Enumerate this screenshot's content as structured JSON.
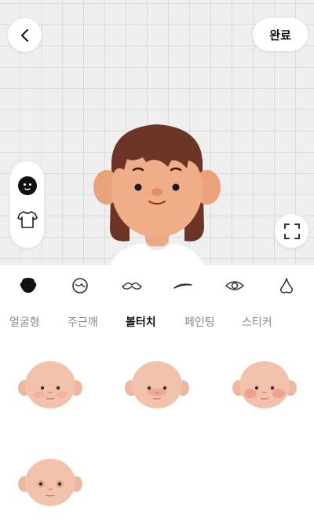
{
  "header": {
    "back_icon": "chevron-left-icon",
    "done_label": "완료"
  },
  "side_toolbar": {
    "items": [
      {
        "icon": "face-icon",
        "active": true
      },
      {
        "icon": "shirt-icon",
        "active": false
      }
    ]
  },
  "expand_icon": "expand-icon",
  "categories": [
    {
      "icon": "face-shape-icon",
      "active": true
    },
    {
      "icon": "head-icon",
      "active": false
    },
    {
      "icon": "mustache-icon",
      "active": false
    },
    {
      "icon": "eyebrow-icon",
      "active": false
    },
    {
      "icon": "eye-icon",
      "active": false
    },
    {
      "icon": "nose-icon",
      "active": false
    }
  ],
  "tabs": [
    {
      "label": "얼굴형",
      "active": false
    },
    {
      "label": "주근깨",
      "active": false
    },
    {
      "label": "볼터치",
      "active": true
    },
    {
      "label": "페인팅",
      "active": false
    },
    {
      "label": "스티커",
      "active": false
    }
  ],
  "face_options": [
    {
      "style": "light-blush"
    },
    {
      "style": "nose-blush"
    },
    {
      "style": "cheek-blush"
    },
    {
      "style": "eye-shadow"
    }
  ],
  "colors": {
    "skin": "#f3c2ac",
    "hair": "#6b3427",
    "grid_bg": "#efefef",
    "active_text": "#111111",
    "inactive_text": "#8a8a8a"
  }
}
